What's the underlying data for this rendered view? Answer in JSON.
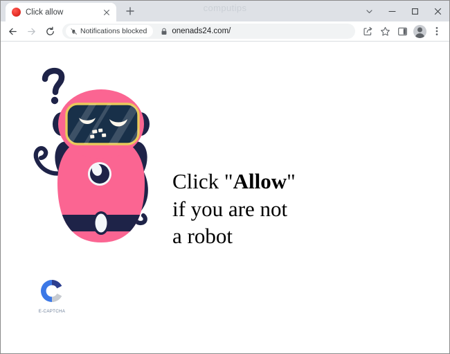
{
  "browser": {
    "watermark": "computips",
    "tab": {
      "title": "Click allow",
      "close_icon": "close-icon",
      "favicon": "site-favicon"
    },
    "new_tab_label": "+",
    "window_controls": {
      "more_label": "⌄",
      "minimize_label": "–",
      "maximize_label": "□",
      "close_label": "✕"
    },
    "toolbar": {
      "back_label": "←",
      "forward_label": "→",
      "reload_label": "↻",
      "notifications_pill": "Notifications blocked",
      "notifications_icon": "bell-slash-icon",
      "lock_icon": "padlock-icon",
      "url": "onenads24.com/",
      "share_icon": "share-icon",
      "bookmark_icon": "star-icon",
      "side_panel_icon": "side-panel-icon",
      "profile_icon": "profile-avatar-icon",
      "menu_icon": "three-dot-menu-icon"
    }
  },
  "page": {
    "headline_line1_prefix": "Click \"",
    "headline_line1_bold": "Allow",
    "headline_line1_suffix": "\"",
    "headline_line2": "if you are not",
    "headline_line3": "a robot",
    "captcha_label": "E-CAPTCHA",
    "robot_alt": "confused-robot-illustration",
    "colors": {
      "robot_body": "#FB6592",
      "robot_dark": "#1E2348",
      "visor": "#183049",
      "visor_border": "#E8C95A",
      "collar": "#FBB040",
      "captcha_blue": "#3C78E6",
      "captcha_dark": "#2C3E8F",
      "captcha_gray": "#C7CBD1",
      "tabstrip": "#DEE1E6"
    }
  }
}
